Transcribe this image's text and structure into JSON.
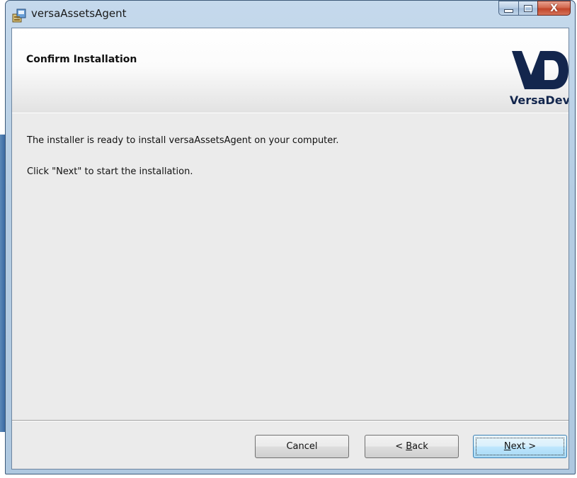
{
  "window": {
    "title": "versaAssetsAgent",
    "caption_buttons": {
      "minimize_icon": "minimize-icon",
      "maximize_icon": "maximize-icon",
      "close_glyph": "X"
    }
  },
  "banner": {
    "title": "Confirm Installation",
    "logo": {
      "mark": "VD",
      "text": "VersaDev",
      "color": "#13264d"
    }
  },
  "content": {
    "line1": "The installer is ready to install versaAssetsAgent on your computer.",
    "line2": "Click \"Next\" to start the installation."
  },
  "buttons": {
    "cancel": {
      "label": "Cancel"
    },
    "back": {
      "prefix": "< ",
      "mnemonic": "B",
      "rest": "ack"
    },
    "next": {
      "mnemonic": "N",
      "rest": "ext >"
    }
  }
}
